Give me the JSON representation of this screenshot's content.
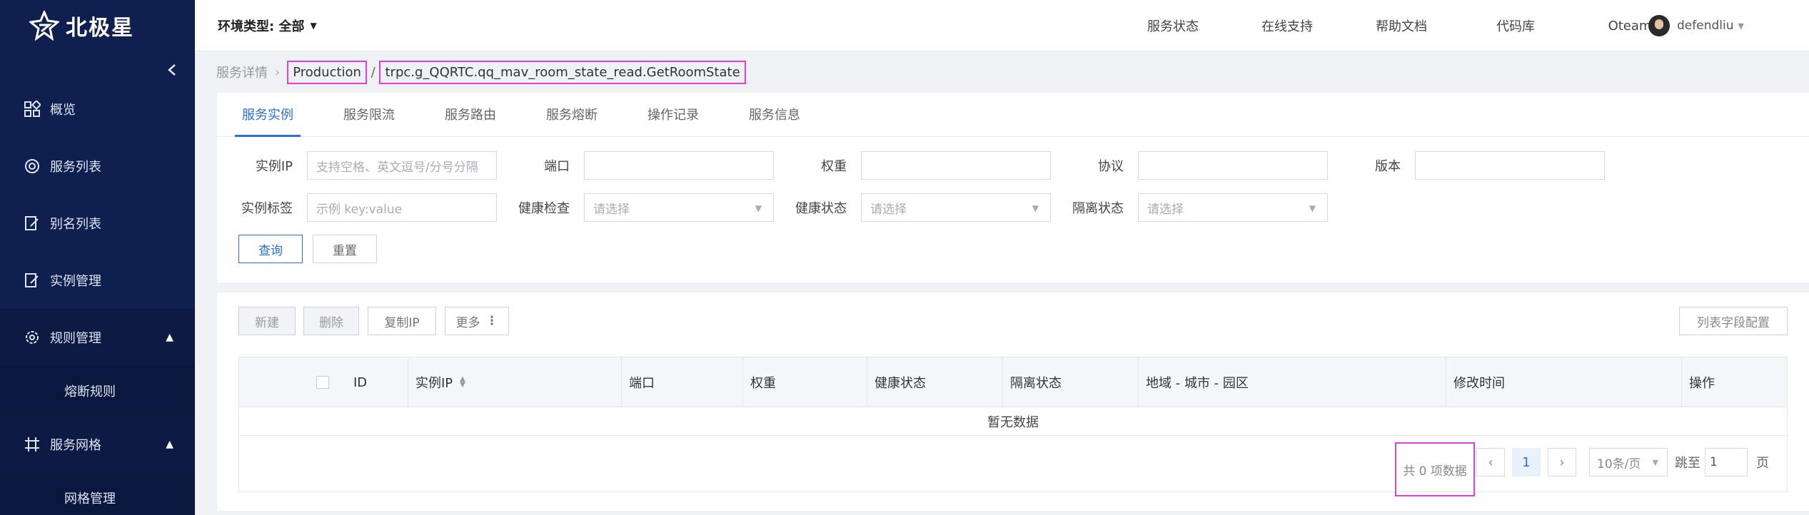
{
  "app": {
    "logo_text": "北极星"
  },
  "sidebar": {
    "items": [
      {
        "label": "概览",
        "icon": "grid-icon"
      },
      {
        "label": "服务列表",
        "icon": "service-icon"
      },
      {
        "label": "别名列表",
        "icon": "edit-doc-icon"
      },
      {
        "label": "实例管理",
        "icon": "edit-doc-icon"
      },
      {
        "label": "规则管理",
        "icon": "gear-icon",
        "expanded": true
      },
      {
        "label": "熔断规则",
        "sub": true
      },
      {
        "label": "服务网格",
        "icon": "mesh-icon",
        "expanded": true
      },
      {
        "label": "网格管理",
        "sub": true
      }
    ]
  },
  "topbar": {
    "env_label": "环境类型: 全部",
    "links": [
      "服务状态",
      "在线支持",
      "帮助文档",
      "代码库",
      "Oteam"
    ],
    "username": "defendliu"
  },
  "breadcrumb": {
    "root": "服务详情",
    "namespace": "Production",
    "separator": " / ",
    "service": "trpc.g_QQRTC.qq_mav_room_state_read.GetRoomState"
  },
  "tabs": [
    "服务实例",
    "服务限流",
    "服务路由",
    "服务熔断",
    "操作记录",
    "服务信息"
  ],
  "active_tab": "服务实例",
  "filters": {
    "instance_ip": {
      "label": "实例IP",
      "placeholder": "支持空格、英文逗号/分号分隔"
    },
    "port": {
      "label": "端口",
      "value": ""
    },
    "weight": {
      "label": "权重",
      "value": ""
    },
    "protocol": {
      "label": "协议",
      "value": ""
    },
    "version": {
      "label": "版本",
      "value": ""
    },
    "instance_tag": {
      "label": "实例标签",
      "placeholder": "示例 key:value"
    },
    "health_check": {
      "label": "健康检查",
      "placeholder": "请选择"
    },
    "health_status": {
      "label": "健康状态",
      "placeholder": "请选择"
    },
    "isolate_status": {
      "label": "隔离状态",
      "placeholder": "请选择"
    },
    "query_button": "查询",
    "reset_button": "重置"
  },
  "toolbar": {
    "new": "新建",
    "delete": "删除",
    "copy_ip": "复制IP",
    "more": "更多",
    "column_config": "列表字段配置"
  },
  "table": {
    "columns": [
      "ID",
      "实例IP",
      "端口",
      "权重",
      "健康状态",
      "隔离状态",
      "地域 - 城市 - 园区",
      "修改时间",
      "操作"
    ],
    "empty_text": "暂无数据"
  },
  "pagination": {
    "total_text": "共 0 项数据",
    "current_page": "1",
    "page_size": "10条/页",
    "jump_prefix": "跳至",
    "jump_value": "1",
    "jump_suffix": "页"
  }
}
